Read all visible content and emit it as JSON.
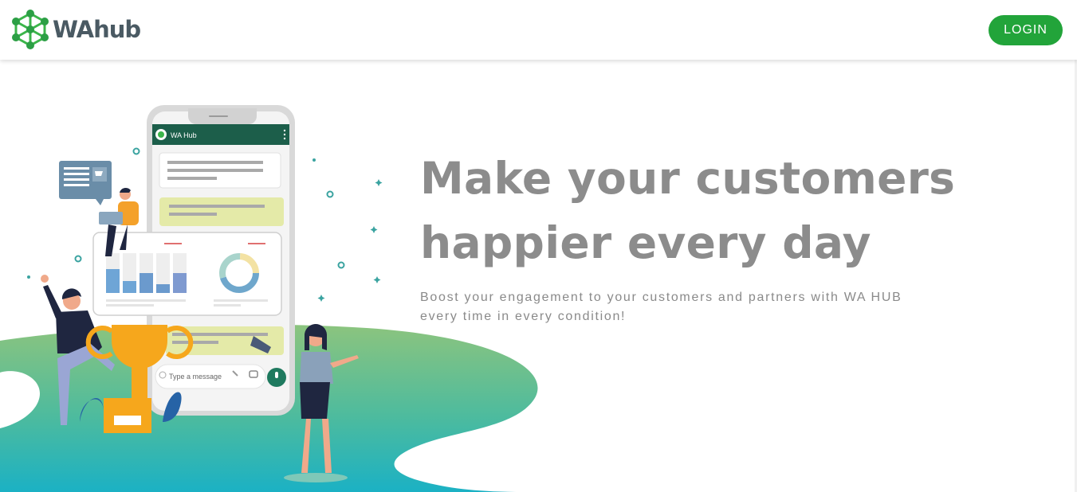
{
  "brand": {
    "name": "WAhub",
    "accent": "#22a43a",
    "text_color": "#4a5a63"
  },
  "nav": {
    "login_label": "LOGIN"
  },
  "hero": {
    "headline": "Make your customers happier every day",
    "subtitle": "Boost your engagement to your customers and partners with WA HUB every time in every condition!"
  },
  "illustration": {
    "chat_header_title": "WA Hub",
    "message_placeholder": "Type a message",
    "colors": {
      "chat_header": "#1c5e4a",
      "bubble_in": "#e4eaa8",
      "wave_top": "#8cc47e",
      "wave_bottom": "#1bb1c4"
    }
  },
  "icons": {
    "logo": "hub-network-icon",
    "mic": "mic-icon",
    "attach": "paperclip-icon",
    "camera": "camera-icon",
    "emoji": "emoji-icon",
    "menu": "kebab-menu-icon",
    "megaphone": "megaphone-icon",
    "trophy": "trophy-icon",
    "cart": "cart-icon"
  }
}
